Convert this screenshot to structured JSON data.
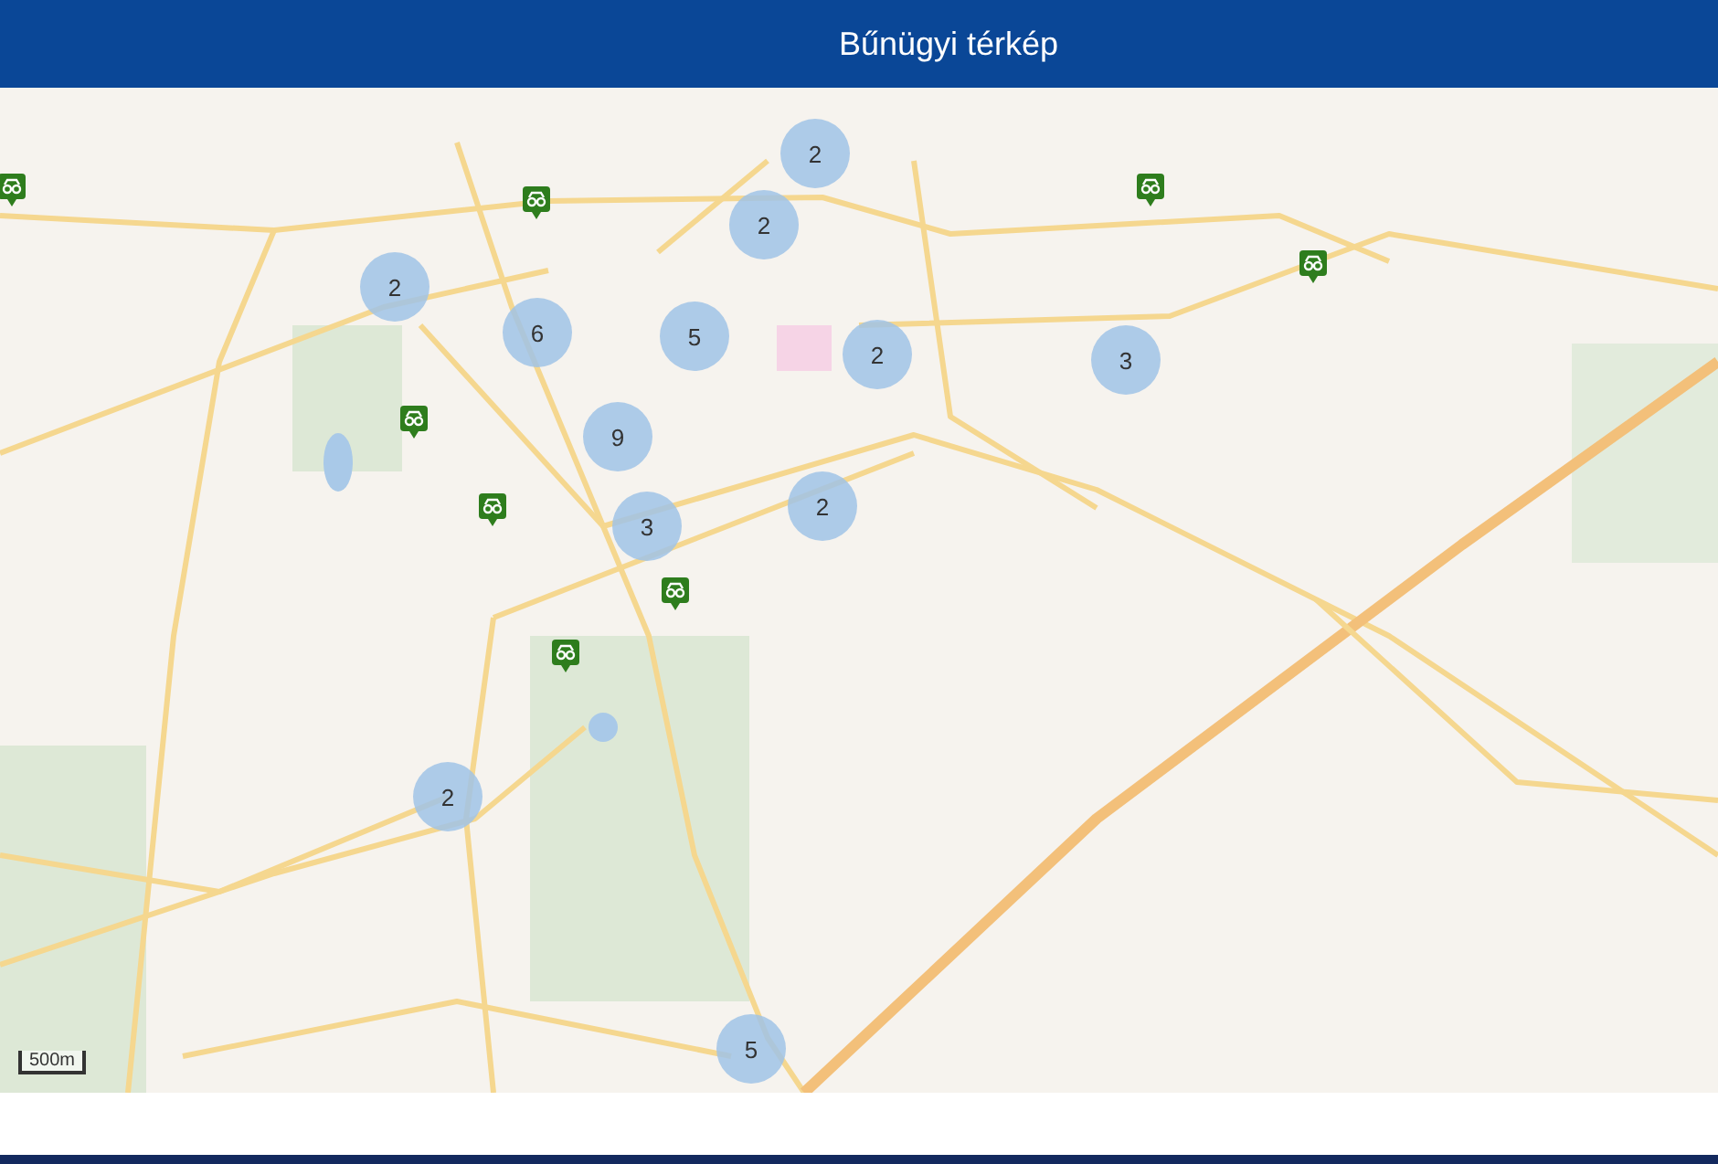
{
  "header": {
    "title": "Bűnügyi térkép"
  },
  "map": {
    "clusters": [
      {
        "count": "2"
      },
      {
        "count": "2"
      },
      {
        "count": "2"
      },
      {
        "count": "6"
      },
      {
        "count": "5"
      },
      {
        "count": "2"
      },
      {
        "count": "3"
      },
      {
        "count": "9"
      },
      {
        "count": "3"
      },
      {
        "count": "2"
      },
      {
        "count": "2"
      },
      {
        "count": "5"
      }
    ],
    "scale": {
      "label": "500m"
    }
  }
}
